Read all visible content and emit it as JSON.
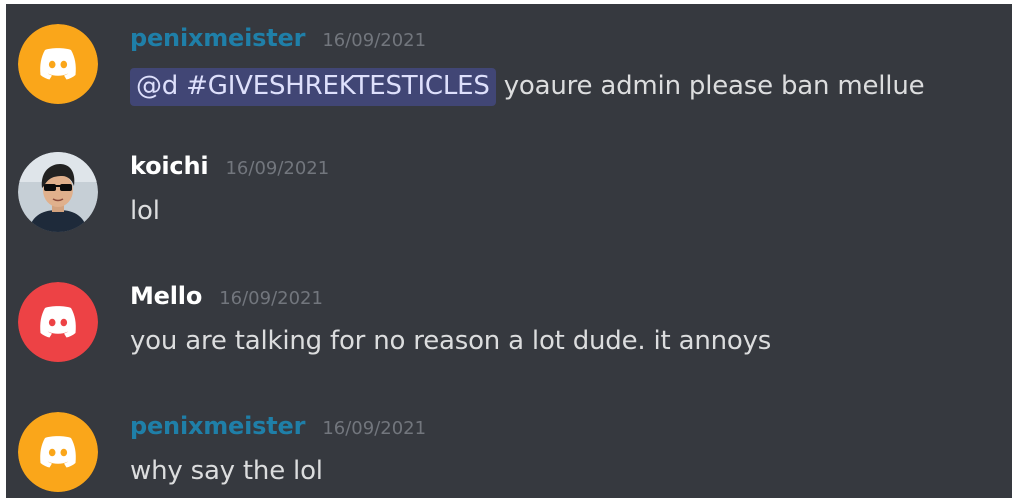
{
  "messages": [
    {
      "username": "penixmeister",
      "timestamp": "16/09/2021",
      "avatar_icon": "discord-logo-icon",
      "avatar_color": "#faa61a",
      "name_color": "#1f7fa8",
      "mention": "@d #GIVESHREKTESTICLES",
      "text": "yoaure admin please ban mellue"
    },
    {
      "username": "koichi",
      "timestamp": "16/09/2021",
      "avatar_icon": "user-photo-avatar",
      "name_color": "#ffffff",
      "text": "lol"
    },
    {
      "username": "Mello",
      "timestamp": "16/09/2021",
      "avatar_icon": "discord-logo-icon",
      "avatar_color": "#ed4245",
      "name_color": "#ffffff",
      "text": "you are talking for no reason a lot dude. it annoys"
    },
    {
      "username": "penixmeister",
      "timestamp": "16/09/2021",
      "avatar_icon": "discord-logo-icon",
      "avatar_color": "#faa61a",
      "name_color": "#1f7fa8",
      "text": "why say the lol"
    }
  ]
}
